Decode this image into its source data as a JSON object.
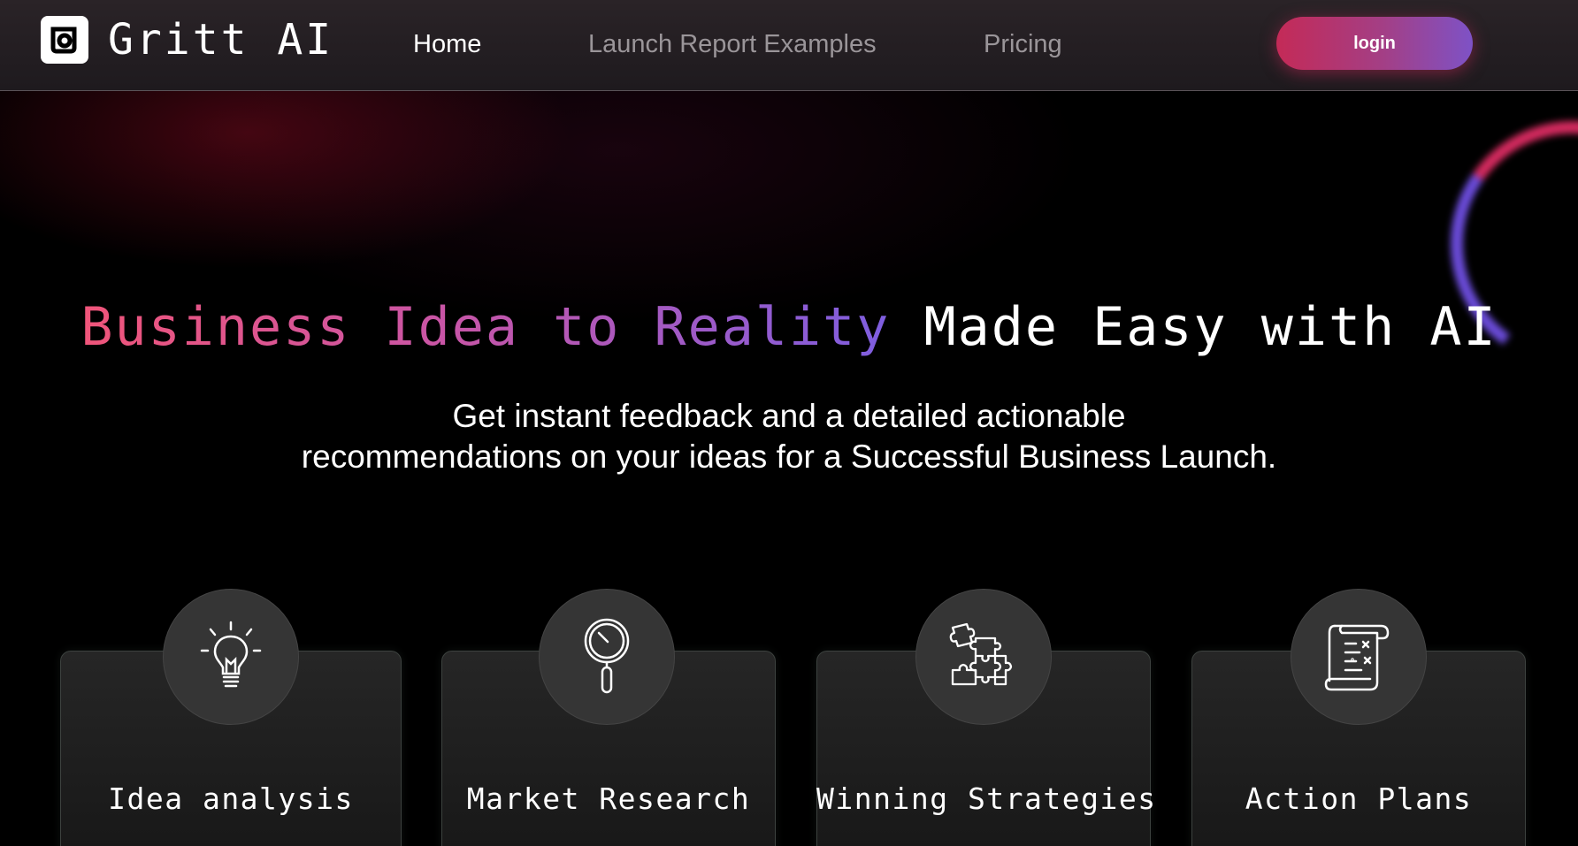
{
  "header": {
    "logo_text": "Gritt AI",
    "nav": [
      "Home",
      "Launch Report Examples",
      "Pricing"
    ],
    "active_nav": "Home",
    "login_label": "login"
  },
  "hero": {
    "title_gradient": "Business Idea to Reality",
    "title_rest": "Made Easy with AI",
    "subtitle_line1": "Get instant feedback and a detailed actionable",
    "subtitle_line2": "recommendations on your ideas for a Successful Business Launch."
  },
  "features": [
    {
      "title": "Idea analysis",
      "icon": "lightbulb-icon"
    },
    {
      "title": "Market Research",
      "icon": "magnifier-icon"
    },
    {
      "title": "Winning Strategies",
      "icon": "puzzle-icon"
    },
    {
      "title": "Action Plans",
      "icon": "scroll-icon"
    }
  ],
  "colors": {
    "accent_pink": "#c42a57",
    "accent_purple": "#7e52c6",
    "background": "#000000"
  }
}
